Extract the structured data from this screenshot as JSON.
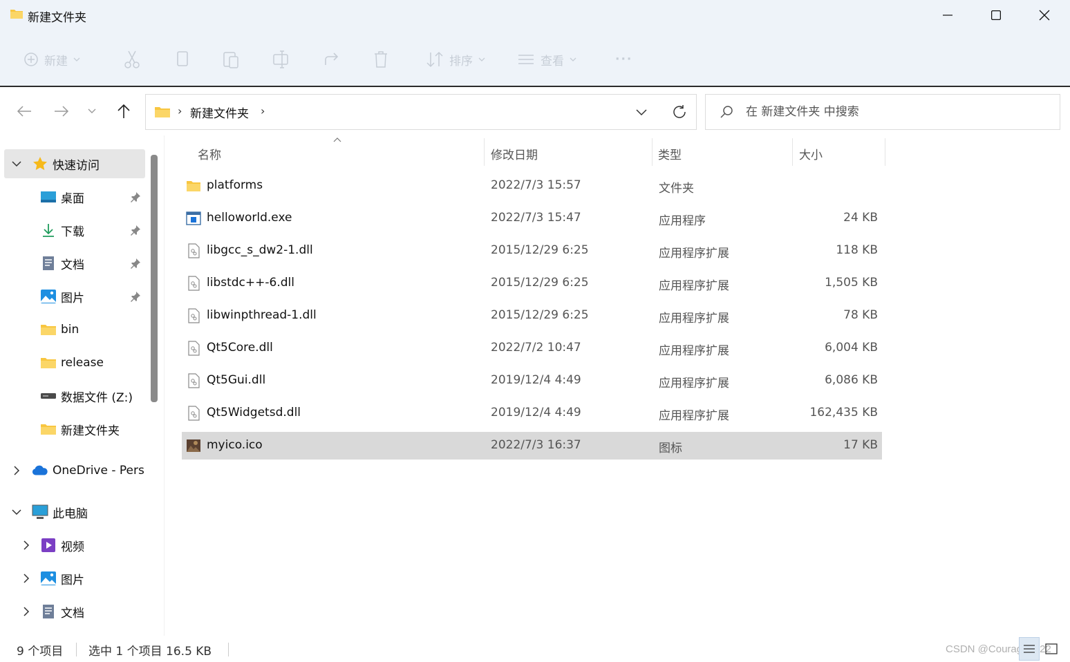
{
  "window": {
    "title": "新建文件夹"
  },
  "commandbar": {
    "new_label": "新建",
    "sort_label": "排序",
    "view_label": "查看",
    "more_label": "···"
  },
  "address": {
    "crumb": "新建文件夹",
    "separator": "›"
  },
  "search": {
    "placeholder": "在 新建文件夹 中搜索"
  },
  "sidebar": {
    "items": [
      {
        "label": "快速访问",
        "icon": "star-icon",
        "expanded": true,
        "selected": true
      },
      {
        "label": "桌面",
        "icon": "desktop-icon",
        "pinned": true
      },
      {
        "label": "下载",
        "icon": "download-icon",
        "pinned": true
      },
      {
        "label": "文档",
        "icon": "document-icon",
        "pinned": true
      },
      {
        "label": "图片",
        "icon": "pictures-icon",
        "pinned": true
      },
      {
        "label": "bin",
        "icon": "folder-icon"
      },
      {
        "label": "release",
        "icon": "folder-icon"
      },
      {
        "label": "数据文件 (Z:)",
        "icon": "drive-icon"
      },
      {
        "label": "新建文件夹",
        "icon": "folder-icon"
      },
      {
        "label": "OneDrive - Pers",
        "icon": "onedrive-icon",
        "expanded": false
      },
      {
        "label": "此电脑",
        "icon": "computer-icon",
        "expanded": true
      },
      {
        "label": "视频",
        "icon": "video-icon",
        "expanded": false
      },
      {
        "label": "图片",
        "icon": "pictures-icon",
        "expanded": false
      },
      {
        "label": "文档",
        "icon": "document-icon",
        "expanded": false
      }
    ]
  },
  "columns": {
    "name": "名称",
    "date": "修改日期",
    "type": "类型",
    "size": "大小"
  },
  "files": [
    {
      "name": "platforms",
      "date": "2022/7/3 15:57",
      "type": "文件夹",
      "size": "",
      "icon": "folder-icon"
    },
    {
      "name": "helloworld.exe",
      "date": "2022/7/3 15:47",
      "type": "应用程序",
      "size": "24 KB",
      "icon": "exe-icon"
    },
    {
      "name": "libgcc_s_dw2-1.dll",
      "date": "2015/12/29 6:25",
      "type": "应用程序扩展",
      "size": "118 KB",
      "icon": "dll-icon"
    },
    {
      "name": "libstdc++-6.dll",
      "date": "2015/12/29 6:25",
      "type": "应用程序扩展",
      "size": "1,505 KB",
      "icon": "dll-icon"
    },
    {
      "name": "libwinpthread-1.dll",
      "date": "2015/12/29 6:25",
      "type": "应用程序扩展",
      "size": "78 KB",
      "icon": "dll-icon"
    },
    {
      "name": "Qt5Core.dll",
      "date": "2022/7/2 10:47",
      "type": "应用程序扩展",
      "size": "6,004 KB",
      "icon": "dll-icon"
    },
    {
      "name": "Qt5Gui.dll",
      "date": "2019/12/4 4:49",
      "type": "应用程序扩展",
      "size": "6,086 KB",
      "icon": "dll-icon"
    },
    {
      "name": "Qt5Widgetsd.dll",
      "date": "2019/12/4 4:49",
      "type": "应用程序扩展",
      "size": "162,435 KB",
      "icon": "dll-icon"
    },
    {
      "name": "myico.ico",
      "date": "2022/7/3 16:37",
      "type": "图标",
      "size": "17 KB",
      "icon": "image-thumbnail-icon",
      "selected": true
    }
  ],
  "status": {
    "item_count": "9 个项目",
    "selection": "选中 1 个项目  16.5 KB"
  },
  "watermark": "CSDN @Courage2022",
  "colors": {
    "chrome_bg": "#eef3f9",
    "selected_row": "#d9d9d9",
    "accent_blue": "#1a73d9",
    "folder_yellow": "#f8c640"
  }
}
